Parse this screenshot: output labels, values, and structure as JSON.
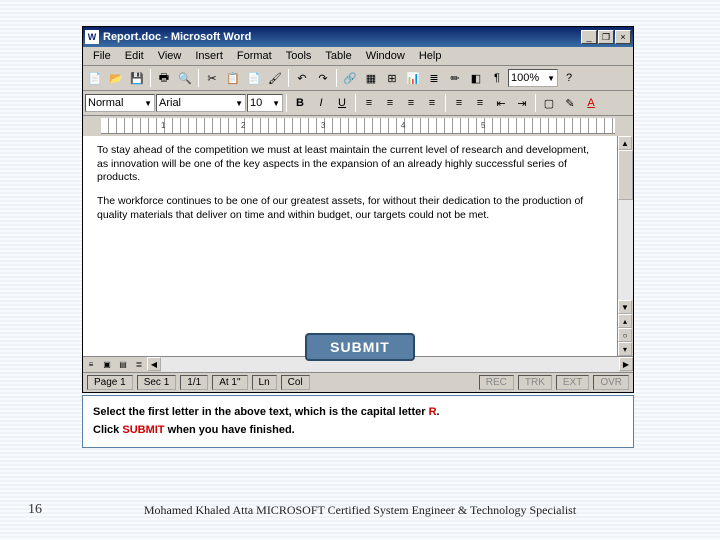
{
  "window": {
    "title": "Report.doc - Microsoft Word"
  },
  "menu": [
    "File",
    "Edit",
    "View",
    "Insert",
    "Format",
    "Tools",
    "Table",
    "Window",
    "Help"
  ],
  "toolbar1": {
    "zoom": "100%"
  },
  "formatbar": {
    "style": "Normal",
    "font": "Arial",
    "size": "10"
  },
  "document": {
    "para1": "To stay ahead of the competition we must at least maintain the current level of research and development, as innovation will be one of the key aspects in the expansion of an already highly successful series of products.",
    "para2": "The workforce continues to be one of our greatest assets, for without their dedication to the production of quality materials that deliver on time and within budget, our targets could not be met."
  },
  "statusbar": {
    "page": "Page 1",
    "sec": "Sec 1",
    "pages": "1/1",
    "at": "At 1\"",
    "ln": "Ln",
    "col": "Col",
    "rec": "REC",
    "trk": "TRK",
    "ext": "EXT",
    "ovr": "OVR"
  },
  "submit_label": "SUBMIT",
  "instructions": {
    "line1a": "Select the first letter in the above text, which is the capital letter ",
    "line1b": "R",
    "line1c": ".",
    "line2a": "Click ",
    "line2b": "SUBMIT",
    "line2c": " when you have finished."
  },
  "slide_number": "16",
  "footer": "Mohamed Khaled Atta MICROSOFT Certified System Engineer & Technology Specialist",
  "ruler_marks": [
    "1",
    "2",
    "3",
    "4",
    "5"
  ]
}
